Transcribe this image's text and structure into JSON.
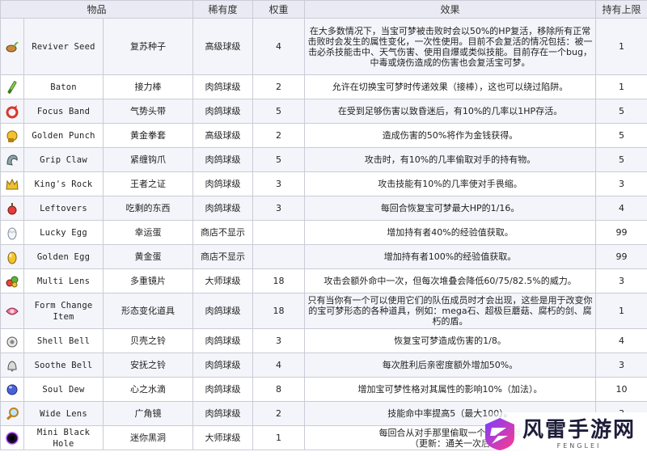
{
  "headers": [
    "物品",
    "稀有度",
    "权重",
    "效果",
    "持有上限"
  ],
  "rows": [
    {
      "icon": "reviver-seed-icon",
      "en": "Reviver Seed",
      "zh": "复苏种子",
      "rarity": "高级球级",
      "weight": "4",
      "effect": "在大多数情况下，当宝可梦被击败时会以50%的HP复活，移除所有正常击败时会发生的属性变化，一次性使用。目前不会复活的情况包括：被一击必杀技能击中、天气伤害、使用自爆或类似技能。目前存在一个bug，中毒或烧伤造成的伤害也会复活宝可梦。",
      "limit": "1"
    },
    {
      "icon": "baton-icon",
      "en": "Baton",
      "zh": "接力棒",
      "rarity": "肉鸽球级",
      "weight": "2",
      "effect": "允许在切换宝可梦时传递效果（接棒），这也可以绕过陷阱。",
      "limit": "1"
    },
    {
      "icon": "focus-band-icon",
      "en": "Focus Band",
      "zh": "气势头带",
      "rarity": "肉鸽球级",
      "weight": "5",
      "effect": "在受到足够伤害以致昏迷后，有10%的几率以1HP存活。",
      "limit": "5"
    },
    {
      "icon": "golden-punch-icon",
      "en": "Golden Punch",
      "zh": "黄金拳套",
      "rarity": "高级球级",
      "weight": "2",
      "effect": "造成伤害的50%将作为金钱获得。",
      "limit": "5"
    },
    {
      "icon": "grip-claw-icon",
      "en": "Grip Claw",
      "zh": "紧缠钩爪",
      "rarity": "肉鸽球级",
      "weight": "5",
      "effect": "攻击时，有10%的几率偷取对手的持有物。",
      "limit": "5"
    },
    {
      "icon": "kings-rock-icon",
      "en": "King's Rock",
      "zh": "王者之证",
      "rarity": "肉鸽球级",
      "weight": "3",
      "effect": "攻击技能有10%的几率使对手畏缩。",
      "limit": "3"
    },
    {
      "icon": "leftovers-icon",
      "en": "Leftovers",
      "zh": "吃剩的东西",
      "rarity": "肉鸽球级",
      "weight": "3",
      "effect": "每回合恢复宝可梦最大HP的1/16。",
      "limit": "4"
    },
    {
      "icon": "lucky-egg-icon",
      "en": "Lucky Egg",
      "zh": "幸运蛋",
      "rarity": "商店不显示",
      "weight": "",
      "effect": "增加持有者40%的经验值获取。",
      "limit": "99"
    },
    {
      "icon": "golden-egg-icon",
      "en": "Golden Egg",
      "zh": "黄金蛋",
      "rarity": "商店不显示",
      "weight": "",
      "effect": "增加持有者100%的经验值获取。",
      "limit": "99"
    },
    {
      "icon": "multi-lens-icon",
      "en": "Multi Lens",
      "zh": "多重镜片",
      "rarity": "大师球级",
      "weight": "18",
      "effect": "攻击会额外命中一次，但每次堆叠会降低60/75/82.5%的威力。",
      "limit": "3"
    },
    {
      "icon": "form-change-item-icon",
      "en": "Form Change Item",
      "zh": "形态变化道具",
      "rarity": "肉鸽球级",
      "weight": "18",
      "effect": "只有当你有一个可以使用它们的队伍成员时才会出现，这些是用于改变你的宝可梦形态的各种道具，例如：mega石、超极巨蘑菇、腐朽的剑、腐朽的盾。",
      "limit": "1"
    },
    {
      "icon": "shell-bell-icon",
      "en": "Shell Bell",
      "zh": "贝壳之铃",
      "rarity": "肉鸽球级",
      "weight": "3",
      "effect": "恢复宝可梦造成伤害的1/8。",
      "limit": "4"
    },
    {
      "icon": "soothe-bell-icon",
      "en": "Soothe Bell",
      "zh": "安抚之铃",
      "rarity": "肉鸽球级",
      "weight": "4",
      "effect": "每次胜利后亲密度额外增加50%。",
      "limit": "3"
    },
    {
      "icon": "soul-dew-icon",
      "en": "Soul Dew",
      "zh": "心之水滴",
      "rarity": "肉鸽球级",
      "weight": "8",
      "effect": "增加宝可梦性格对其属性的影响10%（加法）。",
      "limit": "10"
    },
    {
      "icon": "wide-lens-icon",
      "en": "Wide Lens",
      "zh": "广角镜",
      "rarity": "肉鸽球级",
      "weight": "2",
      "effect": "技能命中率提高5（最大100）。",
      "limit": "3"
    },
    {
      "icon": "mini-black-hole-icon",
      "en": "Mini Black Hole",
      "zh": "迷你黑洞",
      "rarity": "大师球级",
      "weight": "1",
      "effect": "每回合从对手那里偷取一个道具。默\n（更新：通关一次后",
      "limit": ""
    }
  ],
  "watermark": {
    "title": "风雷手游网",
    "subtitle": "FENGLEI"
  }
}
